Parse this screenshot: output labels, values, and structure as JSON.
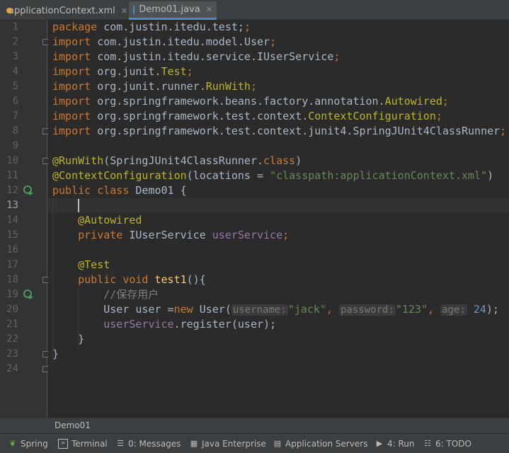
{
  "tabs": [
    {
      "label": "applicationContext.xml",
      "active": false
    },
    {
      "label": "Demo01.java",
      "active": true
    }
  ],
  "breadcrumb": "Demo01",
  "editor": {
    "line_numbers": [
      "1",
      "2",
      "3",
      "4",
      "5",
      "6",
      "7",
      "8",
      "9",
      "10",
      "11",
      "12",
      "13",
      "14",
      "15",
      "16",
      "17",
      "18",
      "19",
      "20",
      "21",
      "22",
      "23",
      "24"
    ],
    "l1": {
      "kw": "package",
      "rest": " com.justin.itedu.test;"
    },
    "l2": {
      "kw": "import",
      "a": " com.justin.itedu.model.",
      "b": "User",
      "c": ";"
    },
    "l3": {
      "kw": "import",
      "a": " com.justin.itedu.service.",
      "b": "IUserService",
      "c": ";"
    },
    "l4": {
      "kw": "import",
      "a": " org.junit.",
      "b": "Test",
      "c": ";"
    },
    "l5": {
      "kw": "import",
      "a": " org.junit.runner.",
      "b": "RunWith",
      "c": ";"
    },
    "l6": {
      "kw": "import",
      "a": " org.springframework.beans.factory.annotation.",
      "b": "Autowired",
      "c": ";"
    },
    "l7": {
      "kw": "import",
      "a": " org.springframework.test.context.",
      "b": "ContextConfiguration",
      "c": ";"
    },
    "l8": {
      "kw": "import",
      "a": " org.springframework.test.context.junit4.",
      "b": "SpringJUnit4ClassRunner",
      "c": ";"
    },
    "l10": {
      "ann": "@RunWith",
      "a": "(SpringJUnit4ClassRunner.",
      "kw": "class",
      "b": ")"
    },
    "l11": {
      "ann": "@ContextConfiguration",
      "a": "(locations = ",
      "str": "\"classpath:applicationContext.xml\"",
      "b": ")"
    },
    "l12": {
      "kw": "public class",
      "rest": " Demo01 {"
    },
    "l14": {
      "ann": "@Autowired"
    },
    "l15": {
      "kw": "private",
      "a": " IUserService ",
      "field": "userService",
      "b": ";"
    },
    "l17": {
      "ann": "@Test"
    },
    "l18": {
      "kw": "public void",
      "fn": " test1",
      "rest": "(){"
    },
    "l19": {
      "comment": "//保存用户"
    },
    "l20": {
      "a": "User user =",
      "kw": "new",
      "b": " User(",
      "h1": "username:",
      "s1": "\"jack\"",
      "sep1": ",",
      "h2": "password:",
      "s2": "\"123\"",
      "sep2": ",",
      "h3": "age:",
      "num": "24",
      "end": ");"
    },
    "l21": {
      "field": "userService",
      "rest": ".register(user);"
    },
    "l22": {
      "rest": "}"
    },
    "l23": {
      "rest": "}"
    }
  },
  "toolwindows": [
    {
      "label": "Spring",
      "icon": "spring-leaf-icon"
    },
    {
      "label": "Terminal",
      "icon": "terminal-icon"
    },
    {
      "label": "0: Messages",
      "icon": "messages-icon"
    },
    {
      "label": "Java Enterprise",
      "icon": "java-enterprise-icon"
    },
    {
      "label": "Application Servers",
      "icon": "application-servers-icon"
    },
    {
      "label": "4: Run",
      "icon": "run-icon"
    },
    {
      "label": "6: TODO",
      "icon": "todo-icon"
    }
  ],
  "colors": {
    "keyword": "#cc7832",
    "annotation": "#bbb529",
    "string": "#6a8759",
    "field": "#9876aa",
    "method": "#ffc66d",
    "number": "#6897bb"
  }
}
